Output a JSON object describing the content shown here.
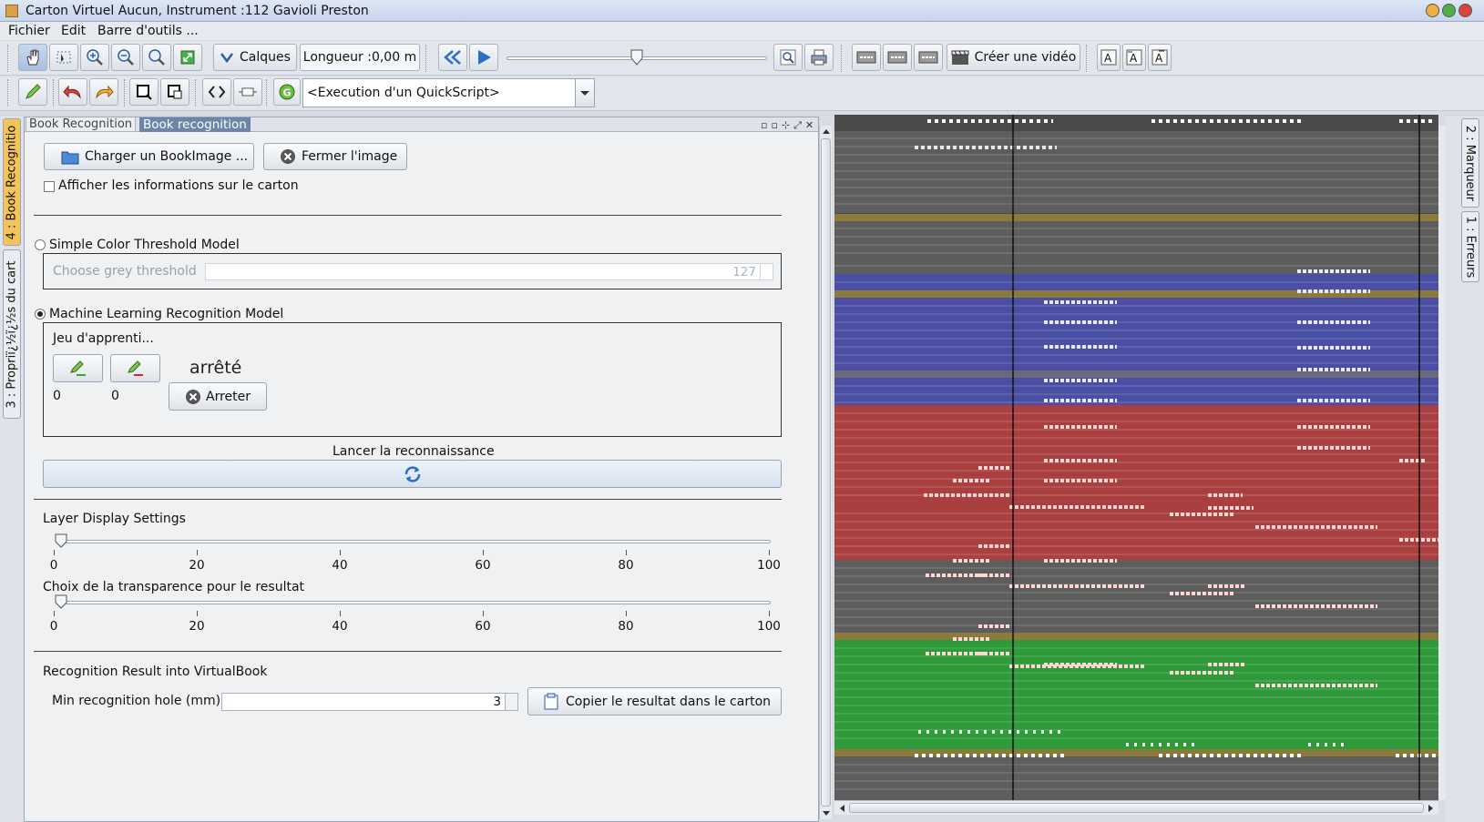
{
  "window": {
    "title": "Carton Virtuel  Aucun, Instrument :112 Gavioli Preston"
  },
  "menubar": {
    "items": [
      "Fichier",
      "Edit",
      "Barre d'outils ..."
    ]
  },
  "toolbar1": {
    "calques_label": "Calques",
    "longueur_label": "Longueur :0,00 m",
    "video_label": "Créer une vidéo"
  },
  "toolbar2": {
    "quickscript_value": "<Execution d'un QuickScript>"
  },
  "left_tabs": [
    "4 : Book Recognitio",
    "3 : Propriï¿½ï¿½s du cart"
  ],
  "right_tabs": [
    "2 : Marqueur",
    "1 : Erreurs"
  ],
  "panel": {
    "tab_inactive": "Book Recognition",
    "tab_active": "Book recognition",
    "load_button": "Charger un BookImage ...",
    "close_button": "Fermer l'image",
    "show_info_label": "Afficher les informations sur le carton",
    "simple_model_label": "Simple Color Threshold Model",
    "grey_threshold_label": "Choose grey threshold",
    "grey_threshold_value": "127",
    "ml_model_label": "Machine Learning Recognition Model",
    "training_set_label": "Jeu d'apprenti...",
    "status_text": "arrêté",
    "count_positive": "0",
    "count_negative": "0",
    "stop_button": "Arreter",
    "launch_label": "Lancer la reconnaissance",
    "layer_display_label": "Layer Display Settings",
    "transparency_label": "Choix de la transparence pour le resultat",
    "slider_ticks": [
      "0",
      "20",
      "40",
      "60",
      "80",
      "100"
    ],
    "layer_slider_value": 0.0,
    "transparency_slider_value": 0.0,
    "result_section_label": "Recognition Result into VirtualBook",
    "min_hole_label": "Min recognition hole (mm)",
    "min_hole_value": "3",
    "copy_button": "Copier le resultat dans le carton"
  },
  "colors": {
    "blue_band": "#4b4fa3",
    "red_band": "#a9403f",
    "green_band": "#2f9a3a",
    "grey_band": "#5d5d5d",
    "accent": "#3a78c8"
  }
}
